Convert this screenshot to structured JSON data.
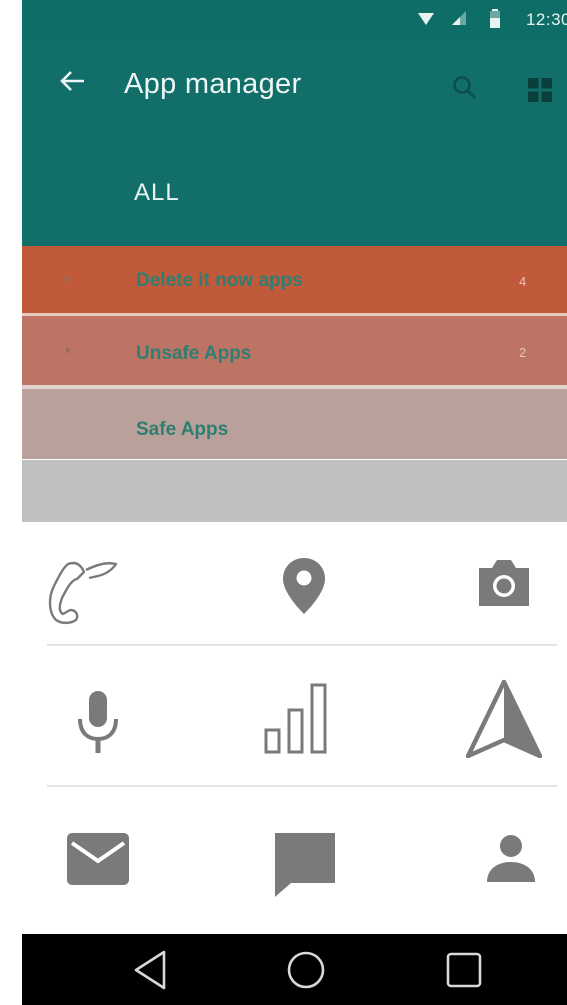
{
  "status_bar": {
    "time": "12:30",
    "icons": [
      "wifi-icon",
      "signal-icon",
      "battery-icon"
    ]
  },
  "app_bar": {
    "title": "App manager",
    "back_icon": "arrow-left-icon",
    "search_icon": "search-icon",
    "view_icon": "grid-icon",
    "tab_label": "ALL"
  },
  "categories": [
    {
      "label": "Delete it now apps",
      "count": "4",
      "color": "#c05a3a"
    },
    {
      "label": "Unsafe Apps",
      "count": "2",
      "color": "#bd7464"
    },
    {
      "label": "Safe Apps",
      "count": "",
      "color": "#b9a09b"
    }
  ],
  "permission_icons": [
    [
      "phone-icon",
      "location-pin-icon",
      "camera-icon"
    ],
    [
      "microphone-icon",
      "signal-bars-icon",
      "navigation-arrow-icon"
    ],
    [
      "mail-icon",
      "chat-bubble-icon",
      "person-icon"
    ]
  ],
  "nav_bar": {
    "icons": [
      "back-triangle-icon",
      "home-circle-icon",
      "recents-square-icon"
    ]
  },
  "colors": {
    "primary": "#116e69",
    "status_bar": "#0e6e67",
    "label_text": "#2e7f72",
    "icon_gray": "#777777"
  }
}
